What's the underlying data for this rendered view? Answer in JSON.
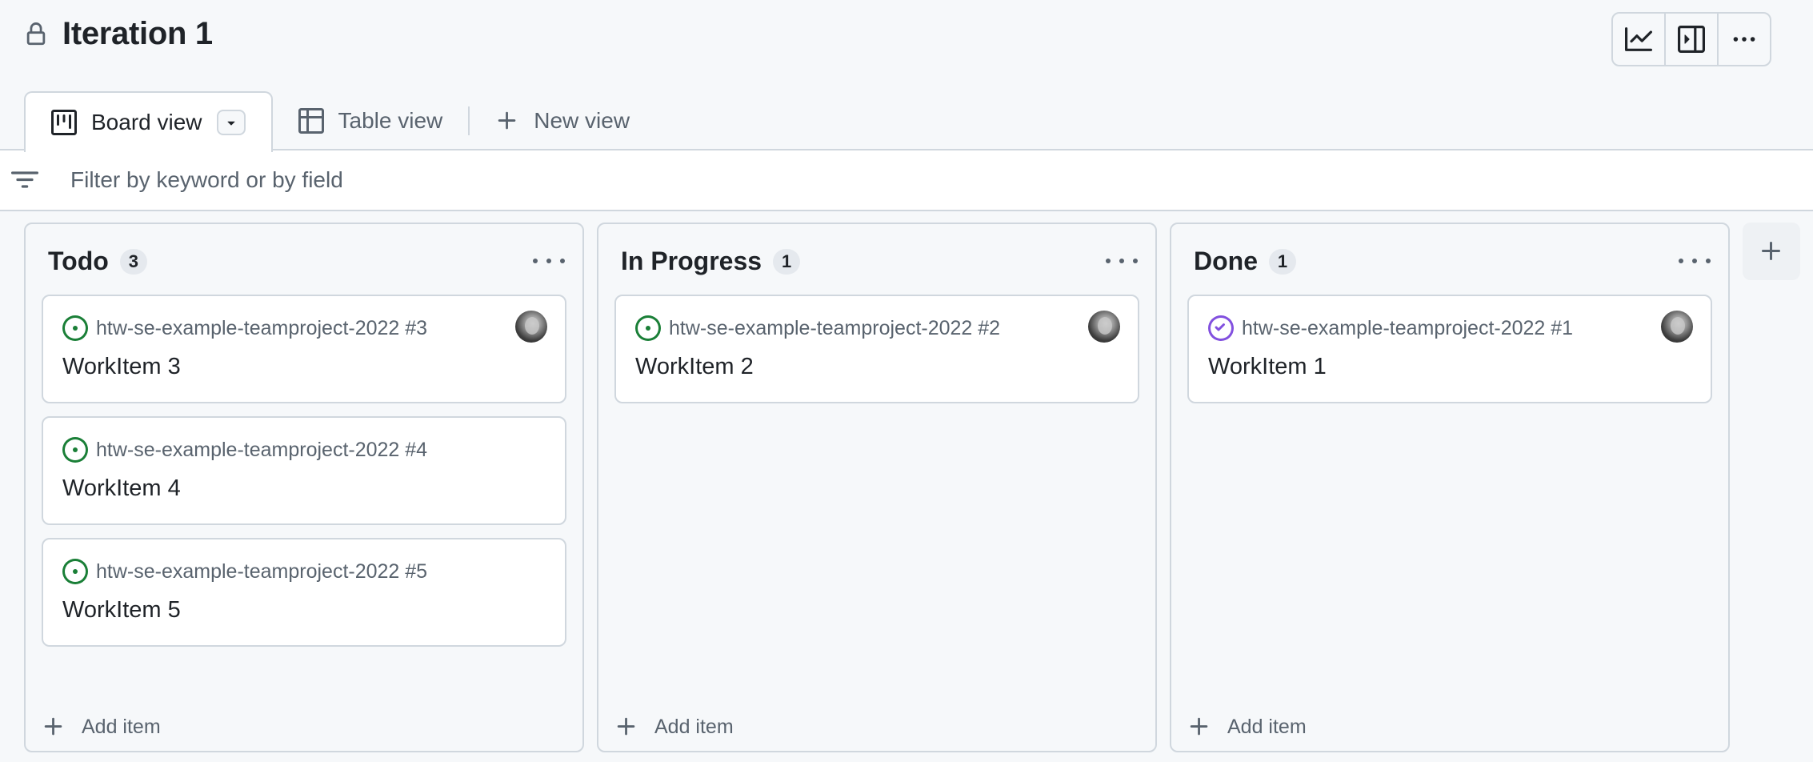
{
  "project": {
    "title": "Iteration 1"
  },
  "tabs": [
    {
      "label": "Board view"
    },
    {
      "label": "Table view"
    },
    {
      "label": "New view"
    }
  ],
  "filter": {
    "placeholder": "Filter by keyword or by field"
  },
  "columns": [
    {
      "name": "Todo",
      "count": "3",
      "items": [
        {
          "ref": "htw-se-example-teamproject-2022 #3",
          "title": "WorkItem 3",
          "status": "open"
        },
        {
          "ref": "htw-se-example-teamproject-2022 #4",
          "title": "WorkItem 4",
          "status": "open"
        },
        {
          "ref": "htw-se-example-teamproject-2022 #5",
          "title": "WorkItem 5",
          "status": "open"
        }
      ],
      "add_label": "Add item"
    },
    {
      "name": "In Progress",
      "count": "1",
      "items": [
        {
          "ref": "htw-se-example-teamproject-2022 #2",
          "title": "WorkItem 2",
          "status": "open"
        }
      ],
      "add_label": "Add item"
    },
    {
      "name": "Done",
      "count": "1",
      "items": [
        {
          "ref": "htw-se-example-teamproject-2022 #1",
          "title": "WorkItem 1",
          "status": "closed"
        }
      ],
      "add_label": "Add item"
    }
  ],
  "icons": {
    "lock": "lock-icon",
    "insights": "graph-icon",
    "side_panel": "sidebar-collapse-icon",
    "more": "kebab-horizontal-icon",
    "board": "project-board-icon",
    "table": "table-icon",
    "plus": "plus-icon",
    "filter": "filter-icon",
    "open_issue": "issue-opened-icon",
    "closed_issue": "issue-closed-icon"
  },
  "colors": {
    "open": "#1a7f37",
    "closed": "#8250df",
    "border": "#d0d7de",
    "muted": "#59636e"
  }
}
